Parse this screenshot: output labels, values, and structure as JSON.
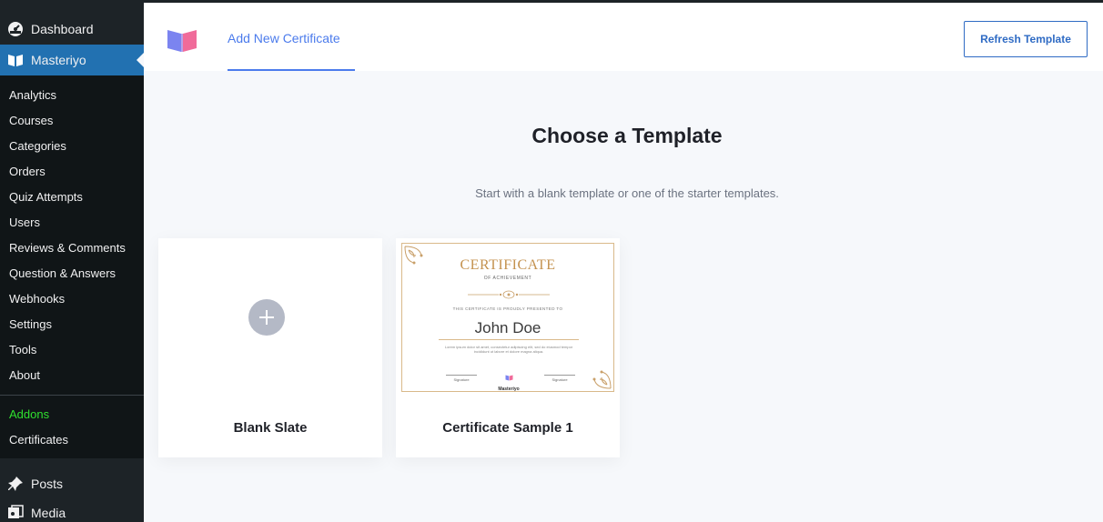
{
  "sidebar": {
    "dashboard": {
      "label": "Dashboard",
      "icon": "dashboard-icon"
    },
    "masteriyo": {
      "label": "Masteriyo",
      "icon": "masteriyo-book-icon"
    },
    "submenu": [
      "Analytics",
      "Courses",
      "Categories",
      "Orders",
      "Quiz Attempts",
      "Users",
      "Reviews & Comments",
      "Question & Answers",
      "Webhooks",
      "Settings",
      "Tools",
      "About"
    ],
    "addons": "Addons",
    "certificates": "Certificates",
    "posts": {
      "label": "Posts",
      "icon": "pin-icon"
    },
    "media": {
      "label": "Media",
      "icon": "media-icon"
    }
  },
  "header": {
    "tab_label": "Add New Certificate",
    "refresh_button": "Refresh Template",
    "logo_icon": "masteriyo-logo-icon"
  },
  "main": {
    "title": "Choose a Template",
    "subtitle": "Start with a blank template or one of the starter templates.",
    "templates": [
      {
        "title": "Blank Slate",
        "icon": "plus-icon"
      },
      {
        "title": "Certificate Sample 1"
      }
    ]
  },
  "certificate_preview": {
    "title": "CERTIFICATE",
    "subtitle": "OF ACHIEVEMENT",
    "presented": "THIS CERTIFICATE IS PROUDLY PRESENTED TO",
    "name": "John Doe",
    "body": "Lorem ipsum dolor sit amet, consectetur adipiscing elit, sed do eiusmod tempor incididunt ut labore et dolore magna aliqua.",
    "signature_left": "Signature",
    "signature_right": "Signature",
    "brand": "Masteriyo"
  },
  "colors": {
    "accent": "#4b7bec",
    "button_border": "#2f6bc4",
    "sidebar_bg": "#1d2327",
    "sidebar_active": "#2271b1",
    "addons_green": "#2fe02f",
    "gold": "#c4924f"
  }
}
